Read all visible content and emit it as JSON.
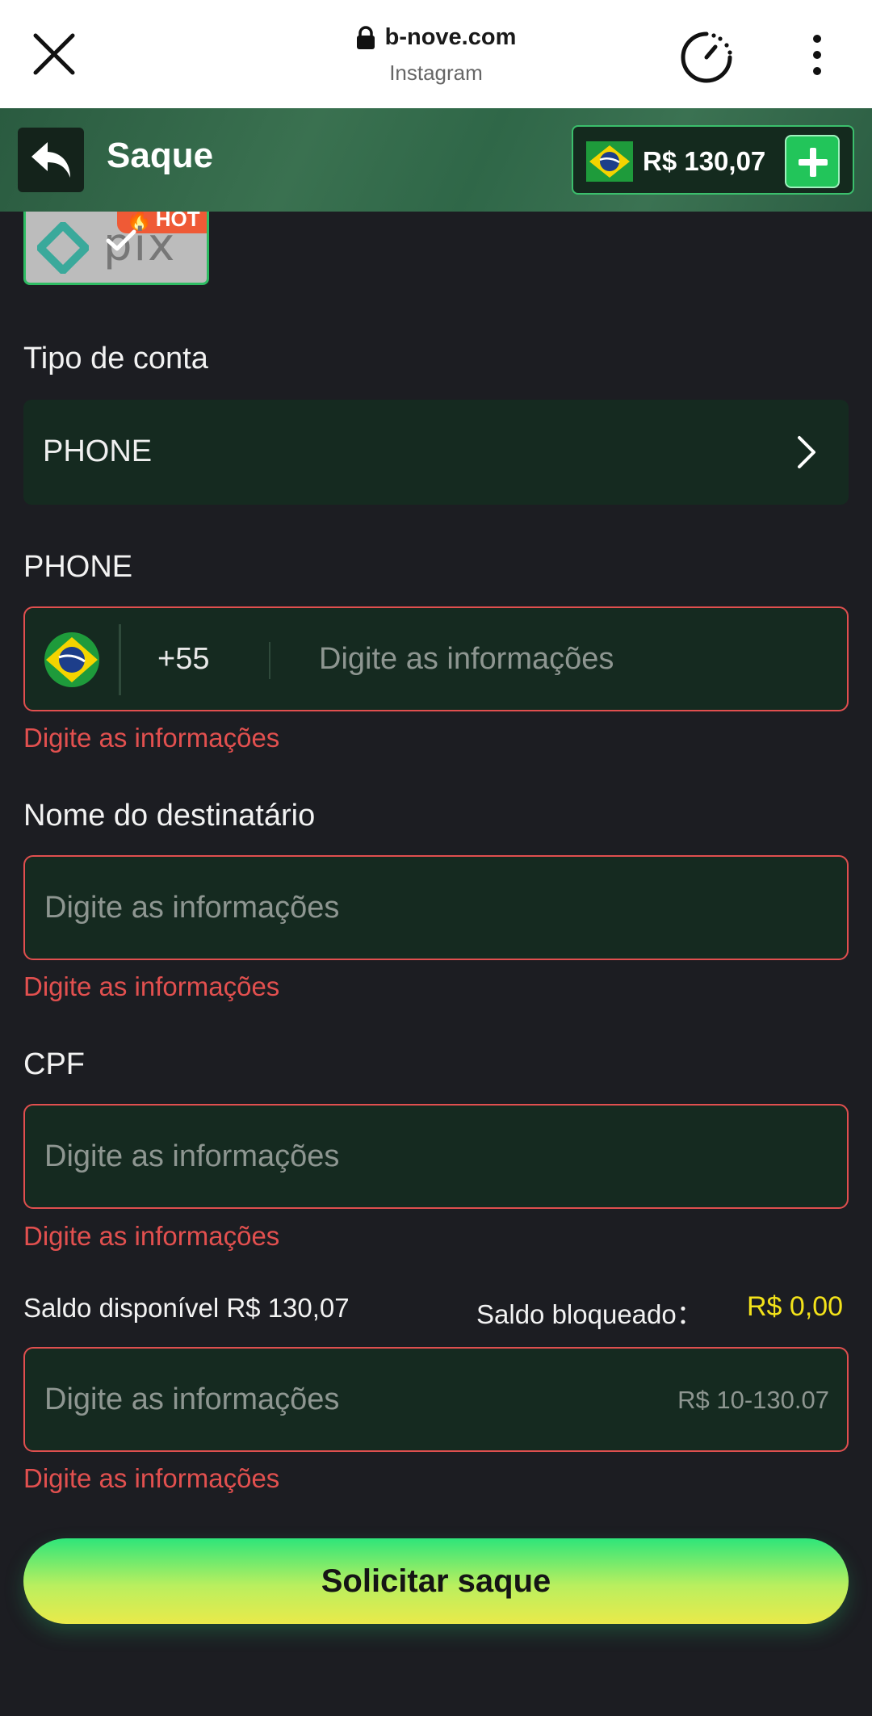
{
  "browser": {
    "domain": "b-nove.com",
    "source": "Instagram"
  },
  "header": {
    "title": "Saque",
    "balance": "R$ 130,07"
  },
  "pix_card": {
    "badge": "HOT",
    "brand_text": "pix"
  },
  "form": {
    "account_type": {
      "label": "Tipo de conta",
      "value": "PHONE"
    },
    "phone": {
      "label": "PHONE",
      "country_code": "+55",
      "placeholder": "Digite as informações",
      "error": "Digite as informações"
    },
    "recipient_name": {
      "label": "Nome do destinatário",
      "placeholder": "Digite as informações",
      "error": "Digite as informações"
    },
    "cpf": {
      "label": "CPF",
      "placeholder": "Digite as informações",
      "error": "Digite as informações"
    },
    "balance": {
      "available_label": "Saldo disponível R$ 130,07",
      "blocked_label": "Saldo bloqueado：",
      "blocked_value": "R$ 0,00"
    },
    "amount": {
      "placeholder": "Digite as informações",
      "range_hint": "R$ 10-130.07",
      "error": "Digite as informações"
    },
    "submit_label": "Solicitar saque"
  },
  "colors": {
    "background": "#1c1d22",
    "field_bg": "#152a20",
    "error": "#e2504f",
    "accent_green": "#22c55a",
    "blocked_yellow": "#f3e21a"
  }
}
